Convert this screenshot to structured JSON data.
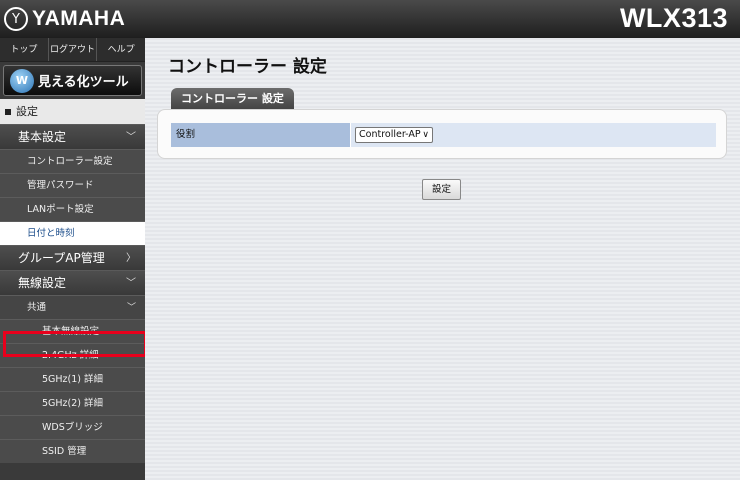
{
  "header": {
    "brand": "YAMAHA",
    "brand_mark": "Y",
    "model": "WLX313"
  },
  "sidebar": {
    "top_links": [
      "トップ",
      "ログアウト",
      "ヘルプ"
    ],
    "viz_button": {
      "label": "見える化ツール",
      "icon": "W"
    },
    "section": "設定",
    "items": [
      {
        "label": "基本設定",
        "type": "group",
        "chevron": "﹀"
      },
      {
        "label": "コントローラー設定",
        "type": "sub"
      },
      {
        "label": "管理パスワード",
        "type": "sub"
      },
      {
        "label": "LANポート設定",
        "type": "sub"
      },
      {
        "label": "日付と時刻",
        "type": "sub-active"
      },
      {
        "label": "グループAP管理",
        "type": "group",
        "chevron": "〉"
      },
      {
        "label": "無線設定",
        "type": "group",
        "chevron": "﹀"
      },
      {
        "label": "共通",
        "type": "category",
        "chevron": "﹀"
      },
      {
        "label": "基本無線設定",
        "type": "sub2"
      },
      {
        "label": "2.4GHz 詳細",
        "type": "sub2"
      },
      {
        "label": "5GHz(1) 詳細",
        "type": "sub2"
      },
      {
        "label": "5GHz(2) 詳細",
        "type": "sub2"
      },
      {
        "label": "WDSブリッジ",
        "type": "sub2"
      },
      {
        "label": "SSID 管理",
        "type": "sub2"
      }
    ]
  },
  "main": {
    "title": "コントローラー 設定",
    "tab": "コントローラー 設定",
    "role_label": "役割",
    "role_value": "Controller-AP",
    "submit": "設定"
  }
}
